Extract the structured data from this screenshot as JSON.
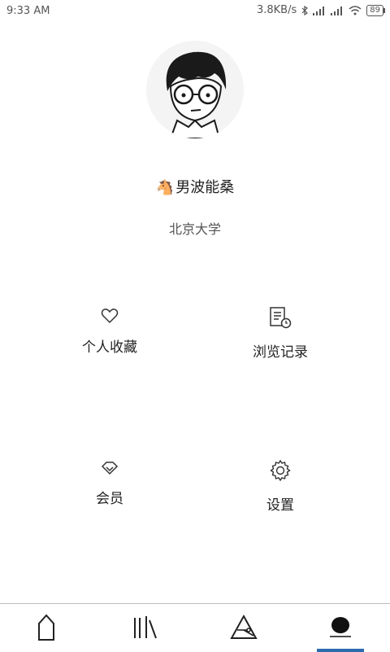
{
  "status_bar": {
    "time": "9:33  AM",
    "speed": "3.8KB/s",
    "battery": "89",
    "icons": [
      "bluetooth-icon",
      "signal-icon",
      "signal-icon",
      "wifi-icon",
      "battery-icon"
    ]
  },
  "profile": {
    "nickname_emoji": "🐴",
    "nickname": "男波能桑",
    "school": "北京大学"
  },
  "actions": {
    "favorites": "个人收藏",
    "history": "浏览记录",
    "vip": "会员",
    "settings": "设置"
  },
  "bottom_nav": {
    "items": [
      "home-icon",
      "library-icon",
      "discover-icon",
      "profile-icon"
    ],
    "active": "profile-icon",
    "accent": "#2b6cb0"
  }
}
